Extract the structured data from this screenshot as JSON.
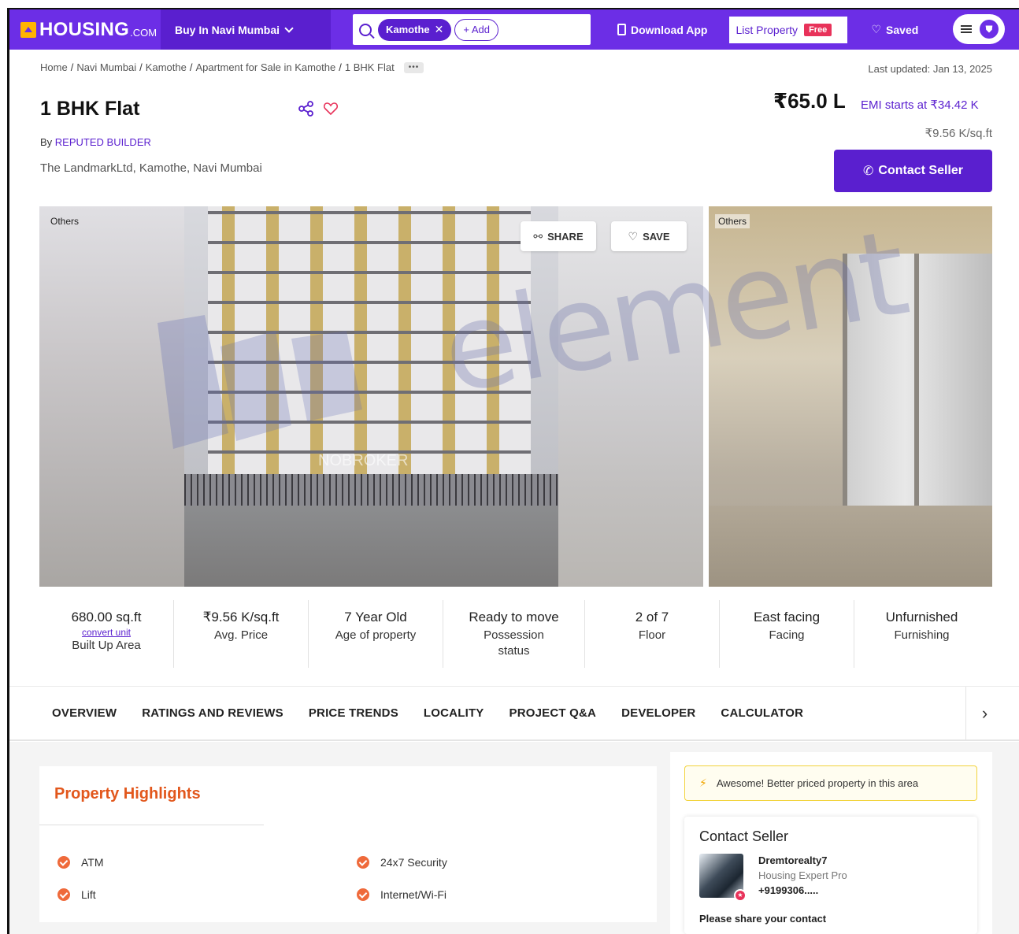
{
  "nav": {
    "logo": "HOUSING",
    "logo_suffix": ".COM",
    "buy_menu": "Buy In Navi Mumbai",
    "search_chip": "Kamothe",
    "add_chip": "+ Add",
    "download_app": "Download App",
    "list_property": "List Property",
    "free_badge": "Free",
    "saved": "Saved"
  },
  "breadcrumb": [
    "Home",
    "Navi Mumbai",
    "Kamothe",
    "Apartment for Sale in Kamothe",
    "1 BHK Flat"
  ],
  "breadcrumb_more": "•••",
  "last_updated": "Last updated: Jan 13, 2025",
  "listing": {
    "title": "1 BHK Flat",
    "by_prefix": "By",
    "builder": "REPUTED BUILDER",
    "address": "The LandmarkLtd, Kamothe, Navi Mumbai",
    "price": "₹65.0 L",
    "emi": "EMI starts at ₹34.42 K",
    "price_per_sqft": "₹9.56 K/sq.ft",
    "contact_button": "Contact Seller"
  },
  "gallery": {
    "label_left": "Others",
    "label_right": "Others",
    "share_button": "SHARE",
    "save_button": "SAVE",
    "photo_watermark": "NOBROKER"
  },
  "stats": [
    {
      "value": "680.00 sq.ft",
      "extra": "convert unit",
      "label": "Built Up Area"
    },
    {
      "value": "₹9.56 K/sq.ft",
      "label": "Avg. Price"
    },
    {
      "value": "7 Year Old",
      "label": "Age of property"
    },
    {
      "value": "Ready to move",
      "label": "Possession status"
    },
    {
      "value": "2 of 7",
      "label": "Floor"
    },
    {
      "value": "East facing",
      "label": "Facing"
    },
    {
      "value": "Unfurnished",
      "label": "Furnishing"
    }
  ],
  "tabs": [
    "OVERVIEW",
    "RATINGS AND REVIEWS",
    "PRICE TRENDS",
    "LOCALITY",
    "PROJECT Q&A",
    "DEVELOPER",
    "CALCULATOR"
  ],
  "highlights": {
    "title": "Property Highlights",
    "items": [
      "ATM",
      "24x7 Security",
      "Lift",
      "Internet/Wi-Fi"
    ]
  },
  "side": {
    "awesome": "Awesome! Better priced property in this area",
    "contact_title": "Contact Seller",
    "agent_name": "Dremtorealty7",
    "agent_role": "Housing Expert Pro",
    "agent_phone": "+9199306.....",
    "share_prompt": "Please share your contact"
  },
  "watermark": "element",
  "colors": {
    "brand": "#6c2ee6",
    "accent": "#5a1fcf",
    "highlight": "#e2571c"
  }
}
